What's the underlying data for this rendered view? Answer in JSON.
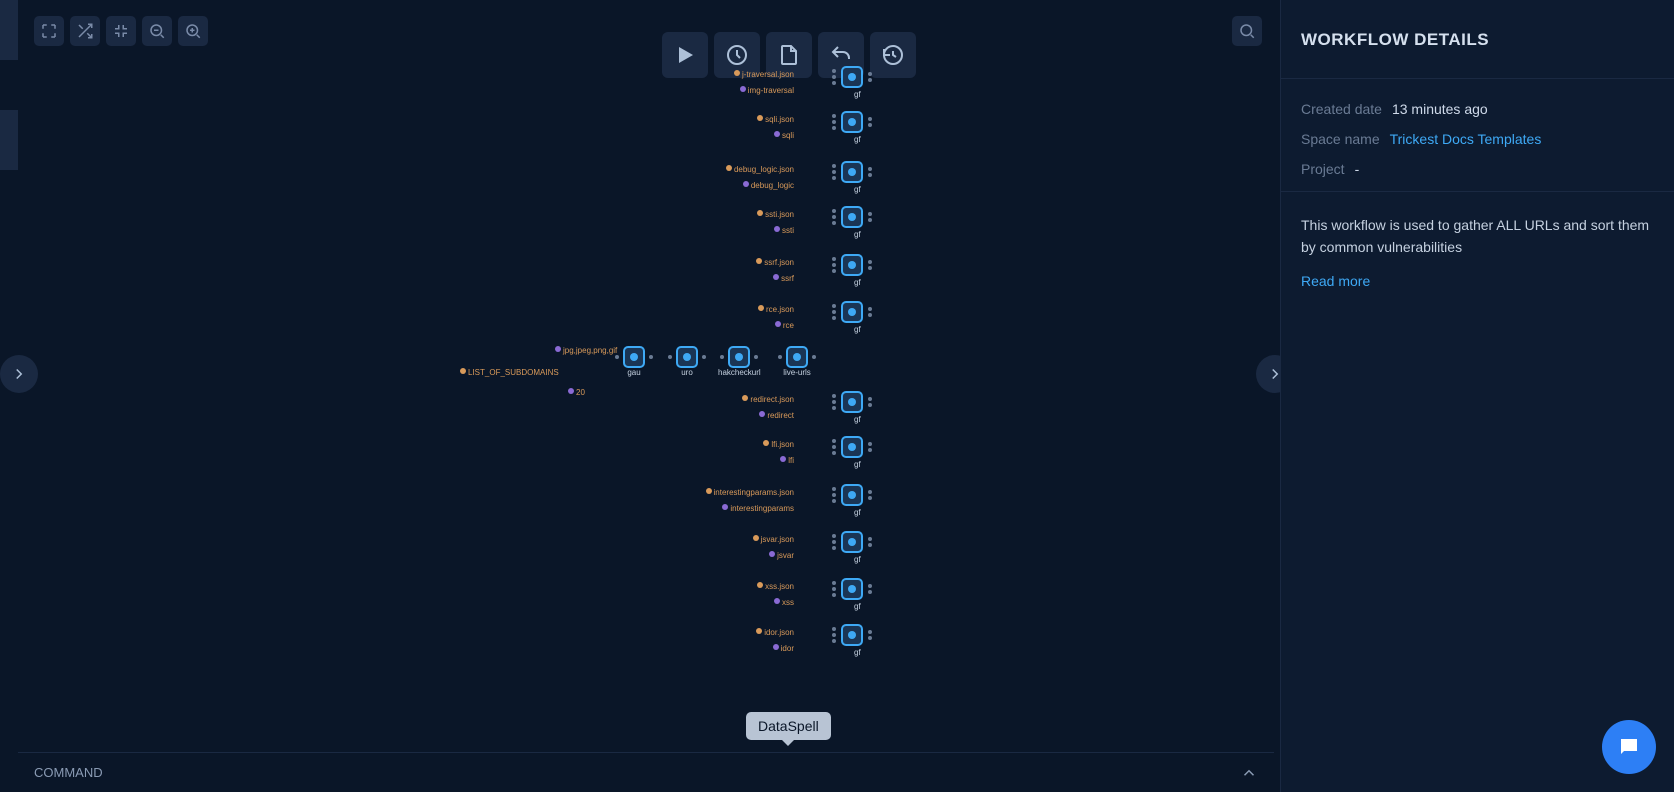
{
  "sidebar": {
    "title": "WORKFLOW DETAILS",
    "created_label": "Created date",
    "created_value": "13 minutes ago",
    "space_label": "Space name",
    "space_value": "Trickest Docs Templates",
    "project_label": "Project",
    "project_value": "-",
    "description": "This workflow is used to gather ALL URLs and sort them by common vulnerabilities",
    "readmore": "Read more"
  },
  "command_bar": {
    "label": "COMMAND"
  },
  "tooltip": "DataSpell",
  "pipeline": {
    "input": "LIST_OF_SUBDOMAINS",
    "ext_filter": "jpg,jpeg,png,gif",
    "num": "20",
    "stages": [
      "gau",
      "uro",
      "hakcheckurl",
      "live-urls"
    ]
  },
  "gf_branches": [
    {
      "json": "j-traversal.json",
      "pat": "img-traversal",
      "out": "gf"
    },
    {
      "json": "sqli.json",
      "pat": "sqli",
      "out": "gf"
    },
    {
      "json": "debug_logic.json",
      "pat": "debug_logic",
      "out": "gf"
    },
    {
      "json": "ssti.json",
      "pat": "ssti",
      "out": "gf"
    },
    {
      "json": "ssrf.json",
      "pat": "ssrf",
      "out": "gf"
    },
    {
      "json": "rce.json",
      "pat": "rce",
      "out": "gf"
    },
    {
      "json": "redirect.json",
      "pat": "redirect",
      "out": "gf"
    },
    {
      "json": "lfi.json",
      "pat": "lfi",
      "out": "gf"
    },
    {
      "json": "interestingparams.json",
      "pat": "interestingparams",
      "out": "gf"
    },
    {
      "json": "jsvar.json",
      "pat": "jsvar",
      "out": "gf"
    },
    {
      "json": "xss.json",
      "pat": "xss",
      "out": "gf"
    },
    {
      "json": "idor.json",
      "pat": "idor",
      "out": "gf"
    }
  ],
  "icons": {
    "fullscreen": "fullscreen-icon",
    "shuffle": "shuffle-icon",
    "compress": "compress-icon",
    "zoomout": "zoom-out-icon",
    "zoomin": "zoom-in-icon",
    "play": "play-icon",
    "clock": "clock-icon",
    "file": "file-icon",
    "undo": "undo-icon",
    "history": "history-icon",
    "search": "search-icon",
    "chat": "chat-icon"
  }
}
